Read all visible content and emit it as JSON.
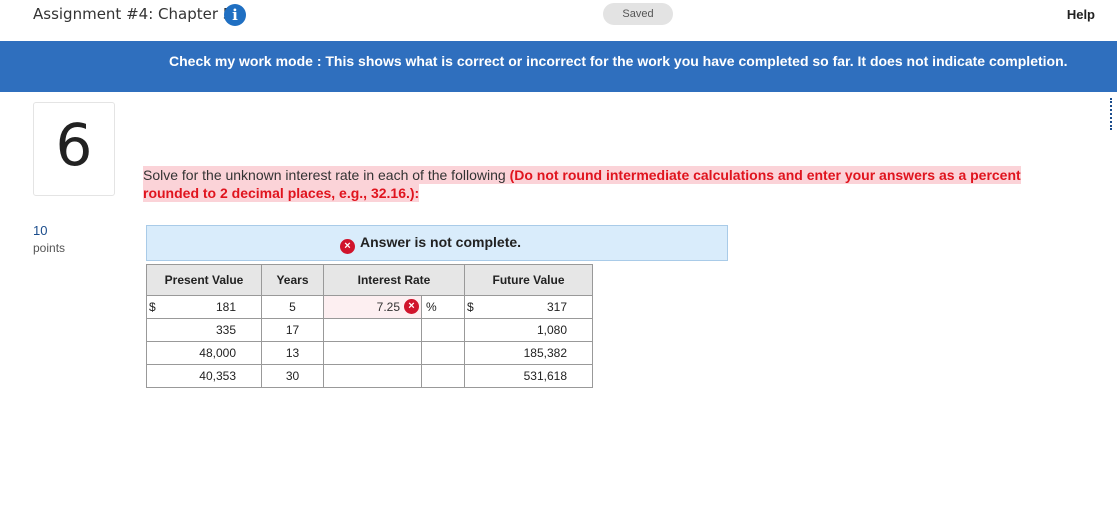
{
  "header": {
    "assignment_title": "Assignment #4: Chapter 5",
    "info_icon": "i",
    "saved_label": "Saved",
    "help_label": "Help"
  },
  "banner": {
    "text": "Check my work mode : This shows what is correct or incorrect for the work you have completed so far. It does not indicate completion."
  },
  "question": {
    "number": "6",
    "points_value": "10",
    "points_label": "points",
    "prompt_main": "Solve for the unknown interest rate in each of the following ",
    "prompt_instruction": "(Do not round intermediate calculations and enter your answers as a percent rounded to 2 decimal places, e.g., 32.16.):"
  },
  "status": {
    "icon": "×",
    "text": "Answer is not complete."
  },
  "table": {
    "headers": {
      "present_value": "Present Value",
      "years": "Years",
      "interest_rate": "Interest Rate",
      "future_value": "Future Value"
    },
    "currency_symbol": "$",
    "percent_symbol": "%",
    "rows": [
      {
        "present_value": "181",
        "years": "5",
        "interest_rate": "7.25",
        "future_value": "317"
      },
      {
        "present_value": "335",
        "years": "17",
        "interest_rate": "",
        "future_value": "1,080"
      },
      {
        "present_value": "48,000",
        "years": "13",
        "interest_rate": "",
        "future_value": "185,382"
      },
      {
        "present_value": "40,353",
        "years": "30",
        "interest_rate": "",
        "future_value": "531,618"
      }
    ]
  },
  "colors": {
    "banner": "#2f6fbe",
    "error_red": "#d0142c",
    "highlight_pink": "#fbd3d8",
    "status_blue": "#d9ecfb"
  }
}
